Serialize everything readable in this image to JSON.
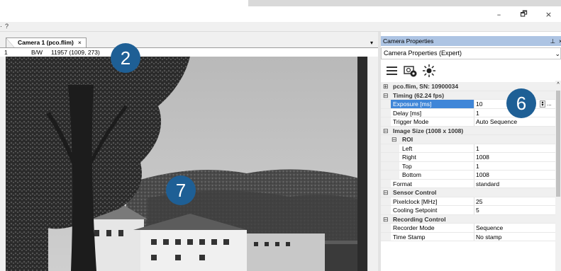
{
  "window": {
    "minimize_glyph": "–",
    "restore_glyph": "🗗",
    "close_glyph": "×"
  },
  "menu": {
    "help_label": "?"
  },
  "document": {
    "tab_title": "Camera 1 (pco.flim)",
    "tab_close": "×",
    "tab_dropdown": "▾",
    "info": {
      "frame": "1",
      "mode": "B/W",
      "pixel": "11957 (1009,  273)"
    }
  },
  "properties_pane": {
    "title": "Camera Properties",
    "pin_glyph": "ᵖ",
    "close_glyph": "×",
    "selector_value": "Camera Properties (Expert)",
    "toolbar_icons": [
      "list-icon",
      "camera-settings-icon",
      "brightness-icon"
    ],
    "rows": [
      {
        "kind": "cat",
        "expander": "⊞",
        "label": "pco.flim, SN: 10900034"
      },
      {
        "kind": "cat",
        "expander": "⊟",
        "label": "Timing (62.24 fps)"
      },
      {
        "kind": "prop",
        "label": "Exposure [ms]",
        "value": "10",
        "selected": true
      },
      {
        "kind": "prop",
        "label": "Delay [ms]",
        "value": "1"
      },
      {
        "kind": "prop",
        "label": "Trigger Mode",
        "value": "Auto Sequence"
      },
      {
        "kind": "cat",
        "expander": "⊟",
        "label": "Image Size (1008 x 1008)"
      },
      {
        "kind": "subcat",
        "expander": "⊟",
        "label": "ROI"
      },
      {
        "kind": "sub",
        "label": "Left",
        "value": "1"
      },
      {
        "kind": "sub",
        "label": "Right",
        "value": "1008"
      },
      {
        "kind": "sub",
        "label": "Top",
        "value": "1"
      },
      {
        "kind": "sub",
        "label": "Bottom",
        "value": "1008"
      },
      {
        "kind": "prop",
        "label": "Format",
        "value": "standard"
      },
      {
        "kind": "cat",
        "expander": "⊟",
        "label": "Sensor Control"
      },
      {
        "kind": "prop",
        "label": "Pixelclock [MHz]",
        "value": "25"
      },
      {
        "kind": "prop",
        "label": "Cooling Setpoint",
        "value": "5"
      },
      {
        "kind": "cat",
        "expander": "⊟",
        "label": "Recording Control"
      },
      {
        "kind": "prop",
        "label": "Recorder Mode",
        "value": "Sequence"
      },
      {
        "kind": "prop",
        "label": "Time Stamp",
        "value": "No stamp"
      }
    ]
  },
  "callouts": {
    "tab_info": "2",
    "exposure": "6",
    "image": "7"
  },
  "colors": {
    "callout": "#1e5f95",
    "selection": "#3f86d8",
    "pane_title": "#adc4e3"
  }
}
